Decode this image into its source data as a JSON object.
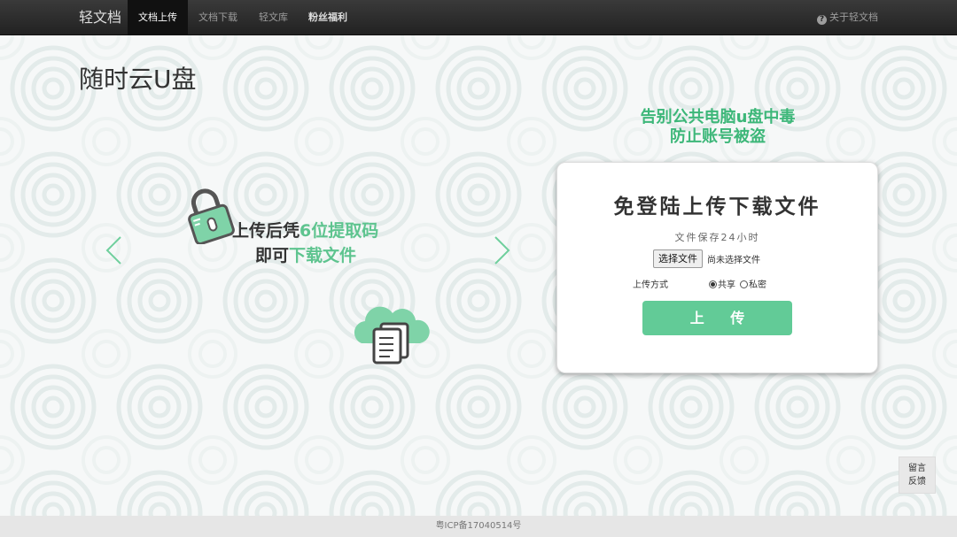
{
  "nav": {
    "brand": "轻文档",
    "items": [
      {
        "label": "文档上传",
        "active": true
      },
      {
        "label": "文档下载",
        "active": false
      },
      {
        "label": "轻文库",
        "active": false
      },
      {
        "label": "粉丝福利",
        "active": false
      }
    ],
    "about": "关于轻文档",
    "about_icon": "question-circle-icon"
  },
  "page_title": "随时云U盘",
  "slogan": {
    "line1": "告别公共电脑u盘中毒",
    "line2": "防止账号被盗"
  },
  "carousel": {
    "line1_plain": "上传后凭",
    "line1_highlight": "6位提取码",
    "line2_plain": "即可",
    "line2_highlight": "下载文件",
    "icons": [
      "lock-icon",
      "cloud-document-icon"
    ]
  },
  "upload_card": {
    "title": "免登陆上传下载文件",
    "subtitle": "文件保存24小时",
    "file_button": "选择文件",
    "file_status": "尚未选择文件",
    "mode_label": "上传方式",
    "mode_options": [
      "共享",
      "私密"
    ],
    "mode_selected": "共享",
    "upload_button": "上 传"
  },
  "feedback": {
    "line1": "留言",
    "line2": "反馈"
  },
  "footer": {
    "icp": "粤ICP备17040514号"
  },
  "colors": {
    "accent": "#62cb97",
    "slogan": "#3db779",
    "navbar": "#222222"
  }
}
